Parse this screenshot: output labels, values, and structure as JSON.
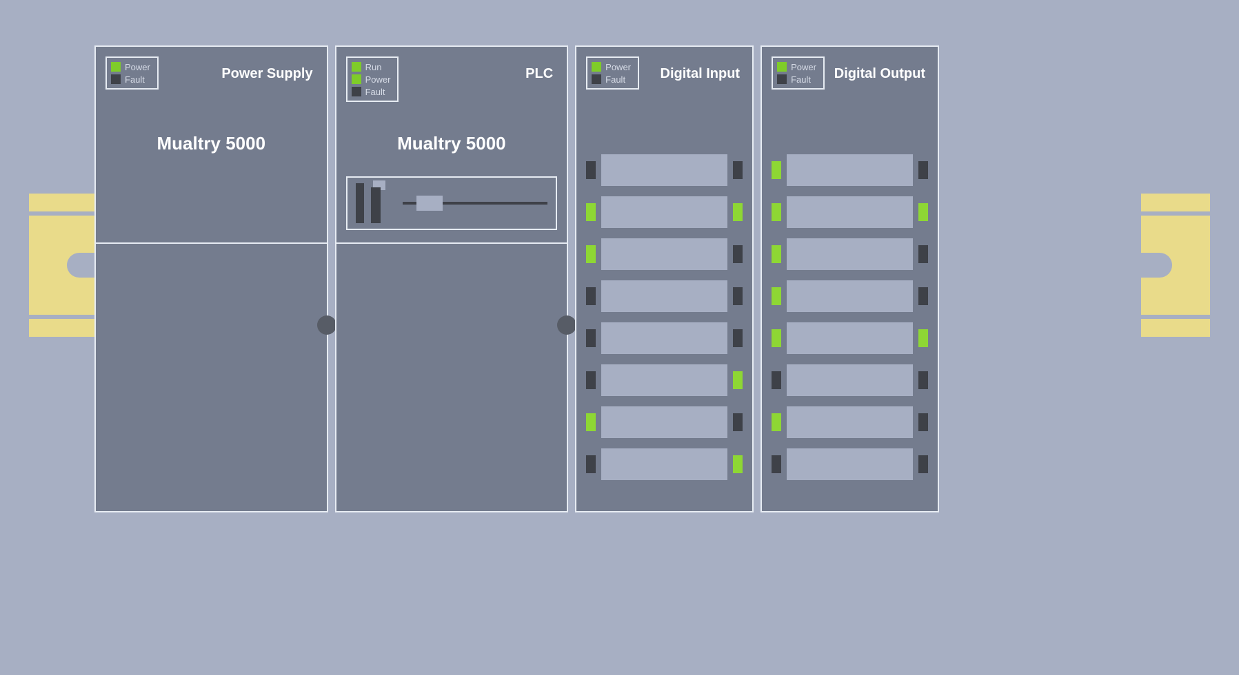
{
  "colors": {
    "background": "#a7afc3",
    "module": "#747c8e",
    "outline": "#e7ecf3",
    "led_on": "#7fcc29",
    "led_off": "#3e4148",
    "channel_on": "#8ed734",
    "bracket": "#e9db8a"
  },
  "modules": {
    "power_supply": {
      "title": "Power Supply",
      "model": "Mualtry 5000",
      "leds": [
        {
          "label": "Power",
          "state": "on"
        },
        {
          "label": "Fault",
          "state": "off"
        }
      ]
    },
    "plc": {
      "title": "PLC",
      "model": "Mualtry 5000",
      "leds": [
        {
          "label": "Run",
          "state": "on"
        },
        {
          "label": "Power",
          "state": "on"
        },
        {
          "label": "Fault",
          "state": "off"
        }
      ]
    },
    "digital_input": {
      "title": "Digital Input",
      "leds": [
        {
          "label": "Power",
          "state": "on"
        },
        {
          "label": "Fault",
          "state": "off"
        }
      ],
      "channels": [
        {
          "left": "off",
          "right": "off"
        },
        {
          "left": "on",
          "right": "on"
        },
        {
          "left": "on",
          "right": "off"
        },
        {
          "left": "off",
          "right": "off"
        },
        {
          "left": "off",
          "right": "off"
        },
        {
          "left": "off",
          "right": "on"
        },
        {
          "left": "on",
          "right": "off"
        },
        {
          "left": "off",
          "right": "on"
        }
      ]
    },
    "digital_output": {
      "title": "Digital Output",
      "leds": [
        {
          "label": "Power",
          "state": "on"
        },
        {
          "label": "Fault",
          "state": "off"
        }
      ],
      "channels": [
        {
          "left": "on",
          "right": "off"
        },
        {
          "left": "on",
          "right": "on"
        },
        {
          "left": "on",
          "right": "off"
        },
        {
          "left": "on",
          "right": "off"
        },
        {
          "left": "on",
          "right": "on"
        },
        {
          "left": "off",
          "right": "off"
        },
        {
          "left": "on",
          "right": "off"
        },
        {
          "left": "off",
          "right": "off"
        }
      ]
    }
  }
}
